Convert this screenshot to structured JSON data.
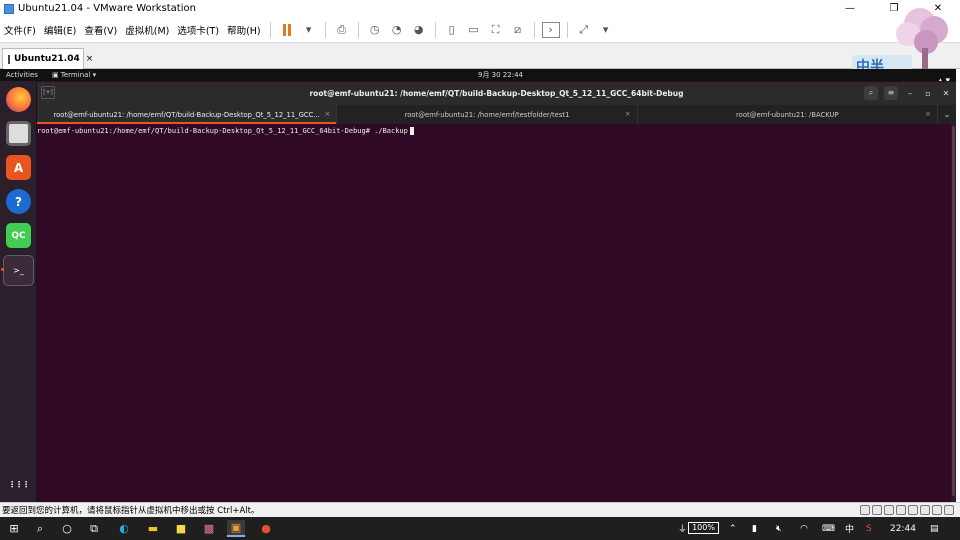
{
  "window": {
    "title": "Ubuntu21.04 - VMware Workstation",
    "btn_min": "—",
    "btn_max": "❐",
    "btn_close": "✕"
  },
  "menu": [
    "文件(F)",
    "编辑(E)",
    "查看(V)",
    "虚拟机(M)",
    "选项卡(T)",
    "帮助(H)"
  ],
  "vm_tab": {
    "label": "Ubuntu21.04",
    "close": "×"
  },
  "mascot_text": "中半",
  "ubuntu": {
    "activities": "Activities",
    "app": "Terminal",
    "app_caret": "▾",
    "clock": "9月 30  22:44",
    "tray": "▴ ▾"
  },
  "dock": [
    {
      "name": "firefox-icon",
      "label": ""
    },
    {
      "name": "files-icon",
      "label": ""
    },
    {
      "name": "software-icon",
      "label": "A"
    },
    {
      "name": "help-icon",
      "label": "?"
    },
    {
      "name": "qt-creator-icon",
      "label": "QC"
    },
    {
      "name": "terminal-icon",
      "label": ">_"
    },
    {
      "name": "app-grid-icon",
      "label": "⋮⋮⋮"
    }
  ],
  "terminal": {
    "title": "root@emf-ubuntu21: /home/emf/QT/build-Backup-Desktop_Qt_5_12_11_GCC_64bit-Debug",
    "new_tab": "[+]",
    "tabs": [
      {
        "label": "root@emf-ubuntu21: /home/emf/QT/build-Backup-Desktop_Qt_5_12_11_GCC...",
        "close": "×"
      },
      {
        "label": "root@emf-ubuntu21: /home/emf/testfolder/test1",
        "close": "×"
      },
      {
        "label": "root@emf-ubuntu21: /BACKUP",
        "close": "×"
      }
    ],
    "tabs_more": "⌄",
    "prompt": "root@emf-ubuntu21:/home/emf/QT/build-Backup-Desktop_Qt_5_12_11_GCC_64bit-Debug# ./Backup"
  },
  "statusbar": {
    "text": "要返回到您的计算机，请将鼠标指针从虚拟机中移出或按 Ctrl+Alt。"
  },
  "taskbar": {
    "battery": "100%",
    "ime": "中",
    "time": "22:44"
  },
  "colors": {
    "terminal_bg": "#300a24",
    "accent": "#e95420",
    "pause": "#e07a1a"
  }
}
